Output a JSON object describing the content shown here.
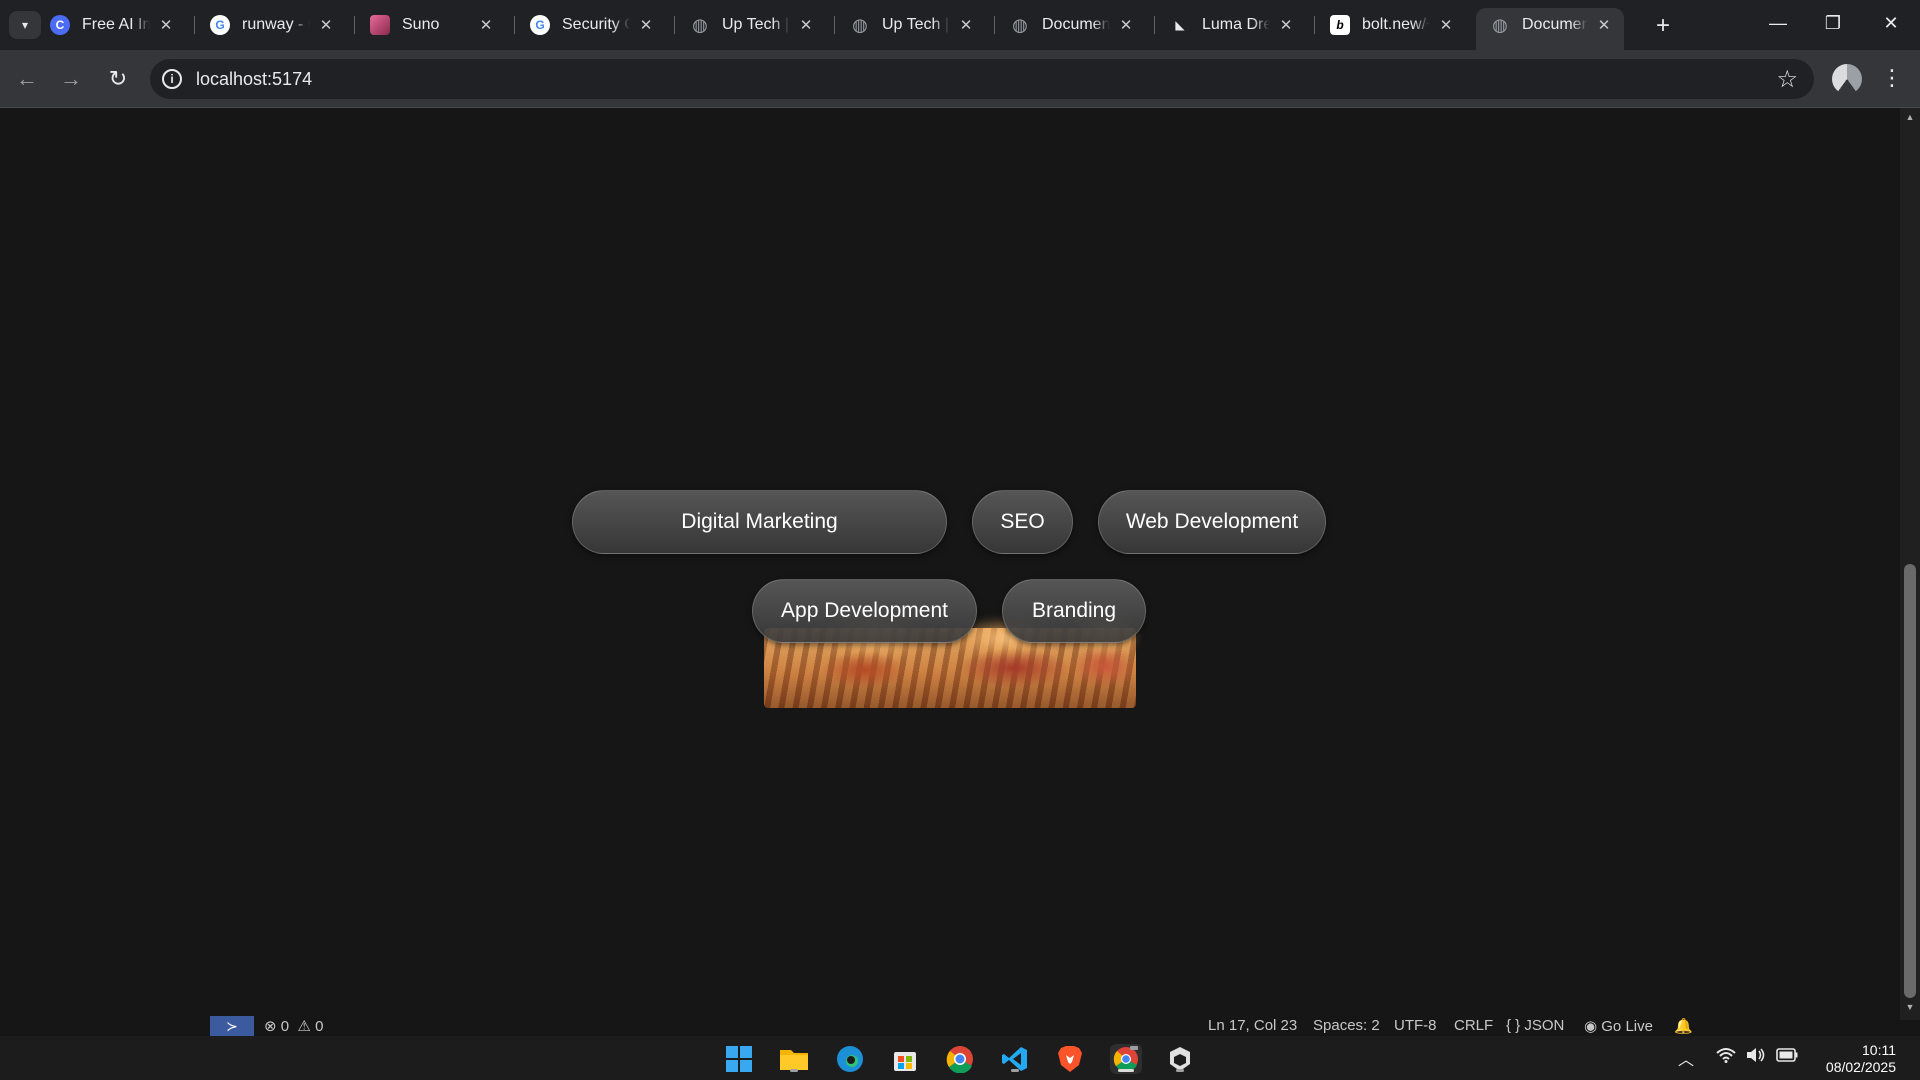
{
  "browser": {
    "tabs": [
      {
        "title": "Free AI Images",
        "icon": "c-logo-icon",
        "color": "#4a6cf7"
      },
      {
        "title": "runway - Google Search",
        "icon": "google-icon",
        "color": "#ffffff"
      },
      {
        "title": "Suno",
        "icon": "suno-icon",
        "color": "#b84a7a"
      },
      {
        "title": "Security Checkup",
        "icon": "google-icon",
        "color": "#ffffff"
      },
      {
        "title": "Up Tech | Innovation",
        "icon": "globe-icon",
        "color": "#9aa0a6"
      },
      {
        "title": "Up Tech | Innovation",
        "icon": "globe-icon",
        "color": "#9aa0a6"
      },
      {
        "title": "Document",
        "icon": "globe-icon",
        "color": "#9aa0a6"
      },
      {
        "title": "Luma Dream Machine",
        "icon": "luma-icon",
        "color": "#e8eaed"
      },
      {
        "title": "bolt.new/~",
        "icon": "bolt-icon",
        "color": "#000000"
      },
      {
        "title": "Document",
        "icon": "globe-icon",
        "color": "#9aa0a6",
        "active": true
      }
    ],
    "close_glyph": "✕",
    "new_tab_glyph": "+",
    "address": {
      "url": "localhost:5174"
    }
  },
  "page": {
    "services": [
      "Digital Marketing",
      "SEO",
      "Web Development",
      "App Development",
      "Branding"
    ]
  },
  "status_bar": {
    "errors": "0",
    "warnings": "0",
    "cursor": "Ln 17, Col 23",
    "spaces": "Spaces: 2",
    "encoding": "UTF-8",
    "eol": "CRLF",
    "language": "JSON",
    "go_live": "Go Live"
  },
  "taskbar": {
    "apps": [
      "windows-start-icon",
      "file-explorer-icon",
      "edge-icon",
      "microsoft-store-icon",
      "chrome-icon",
      "vscode-icon",
      "brave-icon",
      "chrome-dev-icon",
      "app-icon"
    ],
    "time": "10:11",
    "date": "08/02/2025"
  }
}
